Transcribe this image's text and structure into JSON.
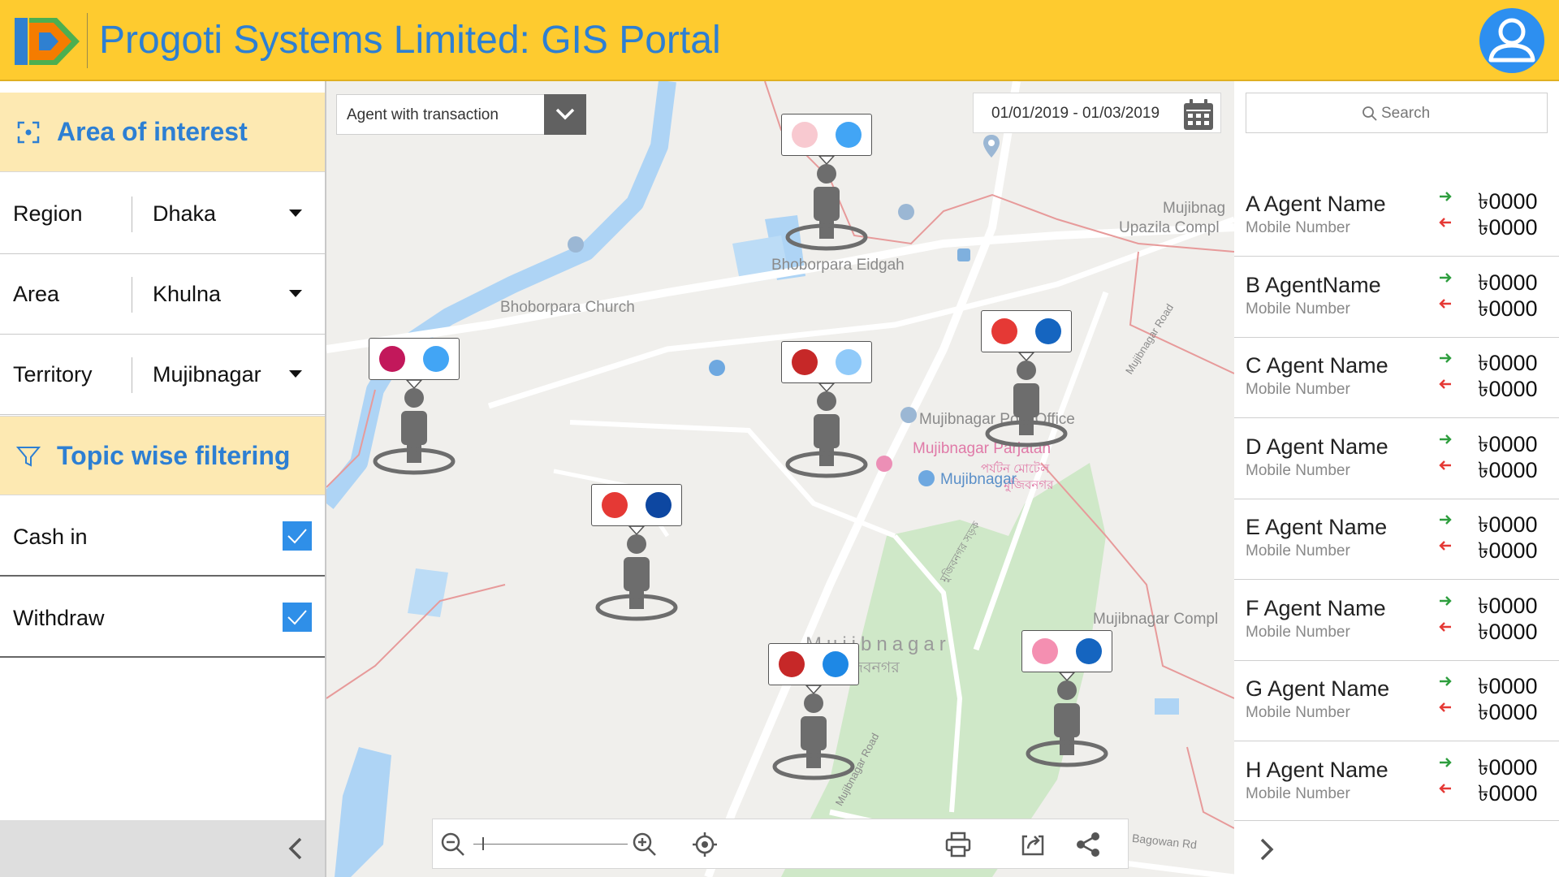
{
  "header": {
    "title": "Progoti Systems Limited: GIS Portal",
    "logo_icon": "progoti-logo",
    "avatar_icon": "user-avatar-icon",
    "bg_color": "#FECB2F",
    "title_color": "#2d7fd3"
  },
  "left_panel": {
    "area_section": {
      "title": "Area of interest",
      "icon": "focus-frame-icon"
    },
    "filters": [
      {
        "label": "Region",
        "value": "Dhaka"
      },
      {
        "label": "Area",
        "value": "Khulna"
      },
      {
        "label": "Territory",
        "value": "Mujibnagar"
      }
    ],
    "topic_section": {
      "title": "Topic wise filtering",
      "icon": "funnel-icon"
    },
    "topics": [
      {
        "label": "Cash in",
        "checked": true
      },
      {
        "label": "Withdraw",
        "checked": true
      }
    ],
    "collapse_icon": "chevron-left-icon"
  },
  "map": {
    "layer_dropdown": {
      "value": "Agent with transaction",
      "icon": "chevron-down-icon"
    },
    "date_range": {
      "value": "01/01/2019 - 01/03/2019",
      "icon": "calendar-icon"
    },
    "labels": {
      "church": "Bhoborpara Church",
      "eidgah": "Bhoborpara Eidgah",
      "upazila_1": "Mujibnag",
      "upazila_2": "Upazila Compl",
      "post_office": "Mujibnagar Post Office",
      "parjatan_1": "Mujibnagar Parjatan",
      "parjatan_2": "পর্যটন মোটেল",
      "parjatan_3": "মুজিবনগর",
      "mujibnagar_right": "Mujibnagar",
      "town_en": "Mujibnagar",
      "town_bn": "মুজিবনগর",
      "complex": "Mujibnagar Compl",
      "mujibnagar_road": "Mujibnagar Road",
      "bagowan_road": "Bagowan Rd",
      "bengali_road": "মুজিবনগর সড়ক"
    },
    "markers": [
      {
        "dot_a": "#F8C9D0",
        "dot_b": "#42A5F5"
      },
      {
        "dot_a": "#C2185B",
        "dot_b": "#42A5F5"
      },
      {
        "dot_a": "#C62828",
        "dot_b": "#90CAF9"
      },
      {
        "dot_a": "#E53935",
        "dot_b": "#1565C0"
      },
      {
        "dot_a": "#E53935",
        "dot_b": "#0D47A1"
      },
      {
        "dot_a": "#C62828",
        "dot_b": "#1E88E5"
      },
      {
        "dot_a": "#F48FB1",
        "dot_b": "#1565C0"
      }
    ],
    "toolbar": {
      "zoom_out_icon": "zoom-out-icon",
      "zoom_level": 0.06,
      "zoom_in_icon": "zoom-in-icon",
      "locate_icon": "crosshair-icon",
      "print_icon": "printer-icon",
      "export_icon": "export-icon",
      "share_icon": "share-icon"
    }
  },
  "right_panel": {
    "search": {
      "placeholder": "Search",
      "icon": "search-icon"
    },
    "agents": [
      {
        "name": "A Agent Name",
        "mobile": "Mobile Number",
        "cash_in": "৳0000",
        "withdraw": "৳0000"
      },
      {
        "name": "B AgentName",
        "mobile": "Mobile Number",
        "cash_in": "৳0000",
        "withdraw": "৳0000"
      },
      {
        "name": "C Agent Name",
        "mobile": "Mobile Number",
        "cash_in": "৳0000",
        "withdraw": "৳0000"
      },
      {
        "name": "D Agent Name",
        "mobile": "Mobile Number",
        "cash_in": "৳0000",
        "withdraw": "৳0000"
      },
      {
        "name": "E Agent Name",
        "mobile": "Mobile Number",
        "cash_in": "৳0000",
        "withdraw": "৳0000"
      },
      {
        "name": "F Agent Name",
        "mobile": "Mobile Number",
        "cash_in": "৳0000",
        "withdraw": "৳0000"
      },
      {
        "name": "G Agent Name",
        "mobile": "Mobile Number",
        "cash_in": "৳0000",
        "withdraw": "৳0000"
      },
      {
        "name": "H Agent Name",
        "mobile": "Mobile Number",
        "cash_in": "৳0000",
        "withdraw": "৳0000"
      }
    ],
    "in_arrow_color": "#2e9e3e",
    "out_arrow_color": "#e53935",
    "expand_icon": "chevron-right-icon"
  }
}
